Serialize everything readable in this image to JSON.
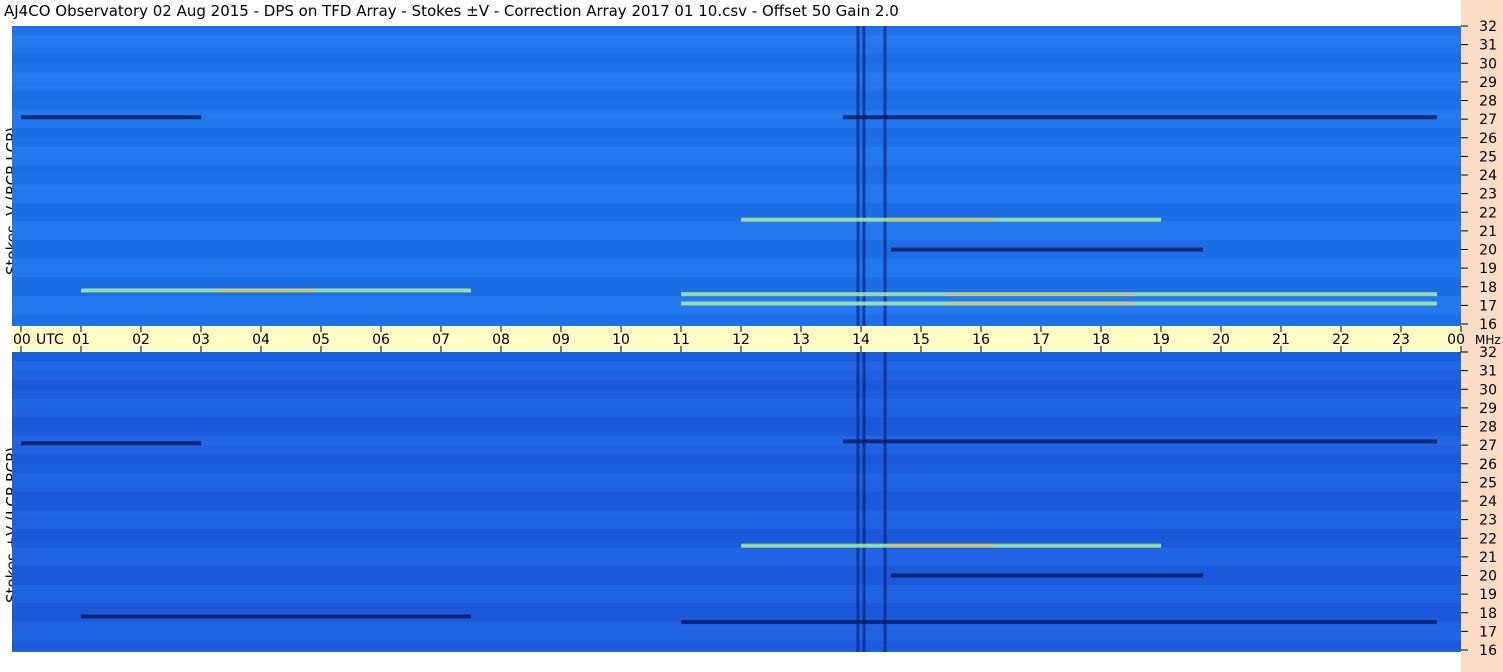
{
  "title": "AJ4CO Observatory  02 Aug 2015  -  DPS on TFD Array  -  Stokes ±V  -  Correction Array 2017 01 10.csv  -  Offset 50  Gain 2.0",
  "colors": {
    "time_bar": "#ffffc8",
    "right_strip": "#fcdcc4",
    "spectrogram_base": "#1e6ee8"
  },
  "chart_data": [
    {
      "type": "heatmap",
      "panel": "top",
      "ylabel": "Stokes -V (RCP-LCP)",
      "x_ticks": [
        "00",
        "01",
        "02",
        "03",
        "04",
        "05",
        "06",
        "07",
        "08",
        "09",
        "10",
        "11",
        "12",
        "13",
        "14",
        "15",
        "16",
        "17",
        "18",
        "19",
        "20",
        "21",
        "22",
        "23",
        "00"
      ],
      "x_unit_label": "UTC",
      "x_range": [
        0,
        24
      ],
      "y_ticks": [
        16,
        17,
        18,
        19,
        20,
        21,
        22,
        23,
        24,
        25,
        26,
        27,
        28,
        29,
        30,
        31,
        32
      ],
      "y_unit_label": "MHz",
      "y_range": [
        16,
        32
      ],
      "ridges": [
        {
          "freq": 27.1,
          "t0": 0.0,
          "t1": 3.0,
          "type": "dark"
        },
        {
          "freq": 27.1,
          "t0": 13.7,
          "t1": 23.6,
          "type": "dark"
        },
        {
          "freq": 17.8,
          "t0": 1.0,
          "t1": 7.5,
          "type": "bright"
        },
        {
          "freq": 17.6,
          "t0": 11.0,
          "t1": 23.6,
          "type": "bright"
        },
        {
          "freq": 17.1,
          "t0": 11.0,
          "t1": 23.6,
          "type": "bright"
        },
        {
          "freq": 21.6,
          "t0": 12.0,
          "t1": 19.0,
          "type": "bright"
        },
        {
          "freq": 20.0,
          "t0": 14.5,
          "t1": 19.7,
          "type": "dark"
        }
      ],
      "vertical_features": [
        13.95,
        14.05,
        14.4
      ]
    },
    {
      "type": "heatmap",
      "panel": "bottom",
      "ylabel": "Stokes +V (LCP-RCP)",
      "x_ticks": [
        "00",
        "01",
        "02",
        "03",
        "04",
        "05",
        "06",
        "07",
        "08",
        "09",
        "10",
        "11",
        "12",
        "13",
        "14",
        "15",
        "16",
        "17",
        "18",
        "19",
        "20",
        "21",
        "22",
        "23",
        "00"
      ],
      "x_unit_label": "UTC",
      "x_range": [
        0,
        24
      ],
      "y_ticks": [
        16,
        17,
        18,
        19,
        20,
        21,
        22,
        23,
        24,
        25,
        26,
        27,
        28,
        29,
        30,
        31,
        32
      ],
      "y_unit_label": "MHz",
      "y_range": [
        16,
        32
      ],
      "ridges": [
        {
          "freq": 27.1,
          "t0": 0.0,
          "t1": 3.0,
          "type": "dark"
        },
        {
          "freq": 27.2,
          "t0": 13.7,
          "t1": 23.6,
          "type": "dark"
        },
        {
          "freq": 17.8,
          "t0": 1.0,
          "t1": 7.5,
          "type": "dark"
        },
        {
          "freq": 17.5,
          "t0": 11.0,
          "t1": 23.6,
          "type": "dark"
        },
        {
          "freq": 21.6,
          "t0": 12.0,
          "t1": 19.0,
          "type": "bright"
        },
        {
          "freq": 20.0,
          "t0": 14.5,
          "t1": 19.7,
          "type": "dark"
        }
      ],
      "vertical_features": [
        13.95,
        14.05,
        14.4
      ]
    }
  ]
}
